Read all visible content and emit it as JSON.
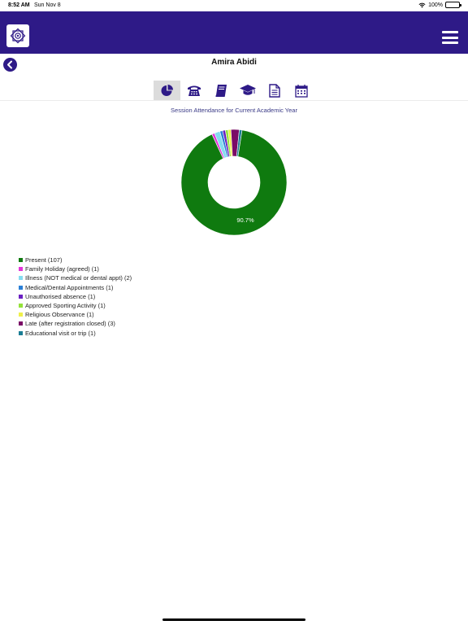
{
  "status_bar": {
    "time": "8:52 AM",
    "date": "Sun Nov 8",
    "battery": "100%"
  },
  "header": {
    "logo_icon": "school-crest-icon",
    "menu_icon": "hamburger-menu-icon",
    "brand_color": "#2e1a87"
  },
  "page": {
    "back_icon": "chevron-left-circle-icon",
    "title": "Amira Abidi"
  },
  "tabs": [
    {
      "icon": "pie-chart-icon",
      "active": true
    },
    {
      "icon": "telephone-icon",
      "active": false
    },
    {
      "icon": "book-icon",
      "active": false
    },
    {
      "icon": "graduation-cap-icon",
      "active": false
    },
    {
      "icon": "document-icon",
      "active": false
    },
    {
      "icon": "calendar-icon",
      "active": false
    }
  ],
  "chart_title": "Session Attendance for Current Academic Year",
  "chart_data": {
    "type": "pie",
    "style": "donut",
    "title": "Session Attendance for Current Academic Year",
    "legend_position": "bottom-left",
    "slices": [
      {
        "label": "Present (107)",
        "name": "Present",
        "value": 107,
        "color": "#0f7a0f"
      },
      {
        "label": "Family Holiday (agreed) (1)",
        "name": "Family Holiday (agreed)",
        "value": 1,
        "color": "#e335d8"
      },
      {
        "label": "Illness (NOT medical or dental appt) (2)",
        "name": "Illness (NOT medical or dental appt)",
        "value": 2,
        "color": "#86dcf0"
      },
      {
        "label": "Medical/Dental Appointments (1)",
        "name": "Medical/Dental Appointments",
        "value": 1,
        "color": "#2a7fd6"
      },
      {
        "label": "Unauthorised absence (1)",
        "name": "Unauthorised absence",
        "value": 1,
        "color": "#6a1fc2"
      },
      {
        "label": "Approved Sporting Activity (1)",
        "name": "Approved Sporting Activity",
        "value": 1,
        "color": "#94e23a"
      },
      {
        "label": "Religious Observance (1)",
        "name": "Religious Observance",
        "value": 1,
        "color": "#eff04a"
      },
      {
        "label": "Late (after registration closed) (3)",
        "name": "Late (after registration closed)",
        "value": 3,
        "color": "#7a0b66"
      },
      {
        "label": "Educational visit or trip (1)",
        "name": "Educational visit or trip",
        "value": 1,
        "color": "#1a7d94"
      }
    ],
    "data_labels": [
      {
        "slice": "Present",
        "text": "90.7%"
      }
    ]
  }
}
